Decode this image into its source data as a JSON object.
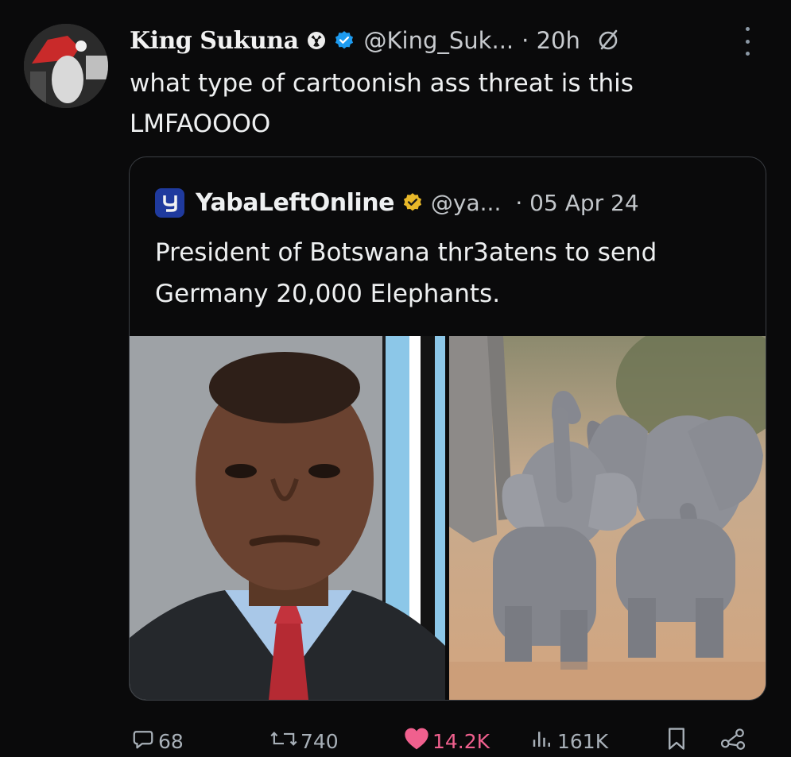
{
  "tweet": {
    "author_name": "King Sukuna",
    "author_handle": "@King_Suk...",
    "time": "· 20h",
    "text_line1": "what type of cartoonish ass threat is this",
    "text_line2": "LMFAOOOO"
  },
  "quote": {
    "author_name": "YabaLeftOnline",
    "author_handle": "@ya...",
    "date": "· 05 Apr 24",
    "text_line1": "President of Botswana thr3atens to send",
    "text_line2": "Germany 20,000 Elephants."
  },
  "actions": {
    "replies": "68",
    "reposts": "740",
    "likes": "14.2K",
    "views": "161K"
  },
  "colors": {
    "verified_blue": "#1d9bf0",
    "verified_gold": "#e8b829",
    "like_pink": "#f0608e",
    "background": "#0a0a0b"
  },
  "icons": [
    "radioactive-icon",
    "verified-badge-icon",
    "no-entry-icon",
    "more-icon",
    "yaba-logo-icon",
    "reply-icon",
    "repost-icon",
    "like-icon",
    "views-icon",
    "bookmark-icon",
    "share-icon"
  ]
}
